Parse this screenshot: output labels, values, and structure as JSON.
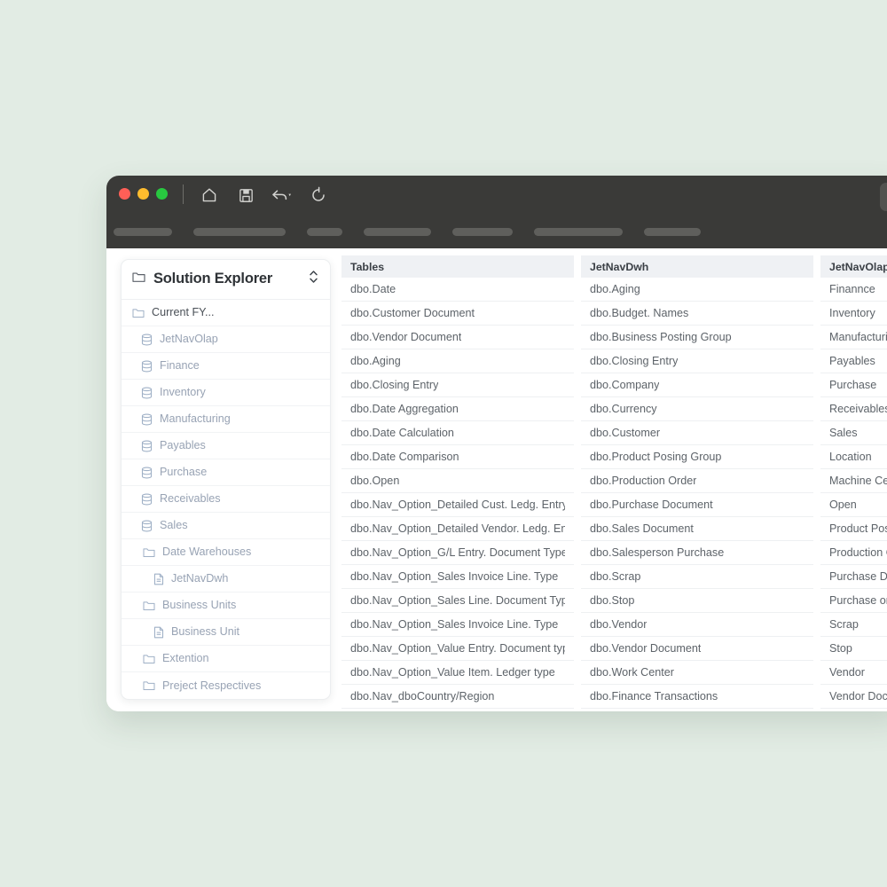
{
  "window": {
    "traffic_lights": [
      "close",
      "minimize",
      "maximize"
    ],
    "toolbar_icons": [
      "home-icon",
      "save-icon",
      "undo-dropdown-icon",
      "refresh-icon"
    ],
    "search_icon": "search-icon",
    "menu_pill_widths": [
      66,
      104,
      40,
      76,
      68,
      100,
      64
    ]
  },
  "sidebar": {
    "title": "Solution Explorer",
    "header_icon": "folder-icon",
    "sort_icon": "chevron-up-down-icon",
    "items": [
      {
        "label": "Current FY...",
        "icon": "folder-icon",
        "level": 0
      },
      {
        "label": "JetNavOlap",
        "icon": "database-icon",
        "level": 1
      },
      {
        "label": "Finance",
        "icon": "database-icon",
        "level": 1
      },
      {
        "label": "Inventory",
        "icon": "database-icon",
        "level": 1
      },
      {
        "label": "Manufacturing",
        "icon": "database-icon",
        "level": 1
      },
      {
        "label": "Payables",
        "icon": "database-icon",
        "level": 1
      },
      {
        "label": "Purchase",
        "icon": "database-icon",
        "level": 1
      },
      {
        "label": "Receivables",
        "icon": "database-icon",
        "level": 1
      },
      {
        "label": "Sales",
        "icon": "database-icon",
        "level": 1
      },
      {
        "label": "Date Warehouses",
        "icon": "folder-icon",
        "level": 1
      },
      {
        "label": "JetNavDwh",
        "icon": "document-icon",
        "level": 2
      },
      {
        "label": "Business Units",
        "icon": "folder-icon",
        "level": 1
      },
      {
        "label": "Business Unit",
        "icon": "document-icon",
        "level": 2
      },
      {
        "label": "Extention",
        "icon": "folder-icon",
        "level": 1
      },
      {
        "label": "Preject Respectives",
        "icon": "folder-icon",
        "level": 1
      }
    ]
  },
  "tables": [
    {
      "header": "Tables",
      "rows": [
        "dbo.Date",
        "dbo.Customer Document",
        "dbo.Vendor Document",
        "dbo.Aging",
        "dbo.Closing Entry",
        "dbo.Date Aggregation",
        "dbo.Date Calculation",
        "dbo.Date Comparison",
        "dbo.Open",
        "dbo.Nav_Option_Detailed Cust. Ledg. Entry...",
        "dbo.Nav_Option_Detailed Vendor. Ledg. En...",
        "dbo.Nav_Option_G/L Entry. Document Type",
        "dbo.Nav_Option_Sales Invoice Line. Type",
        "dbo.Nav_Option_Sales Line. Document Type",
        "dbo.Nav_Option_Sales Invoice Line. Type",
        "dbo.Nav_Option_Value Entry. Document type",
        "dbo.Nav_Option_Value Item. Ledger type",
        "dbo.Nav_dboCountry/Region"
      ]
    },
    {
      "header": "JetNavDwh",
      "rows": [
        "dbo.Aging",
        "dbo.Budget. Names",
        "dbo.Business Posting Group",
        "dbo.Closing Entry",
        "dbo.Company",
        "dbo.Currency",
        "dbo.Customer",
        "dbo.Product Posing Group",
        "dbo.Production Order",
        "dbo.Purchase Document",
        "dbo.Sales Document",
        "dbo.Salesperson Purchase",
        "dbo.Scrap",
        "dbo.Stop",
        "dbo.Vendor",
        "dbo.Vendor Document",
        "dbo.Work Center",
        "dbo.Finance Transactions"
      ]
    },
    {
      "header": "JetNavOlap",
      "rows": [
        "Finannce",
        "Inventory",
        "Manufacturing",
        "Payables",
        "Purchase",
        "Receivables",
        "Sales",
        "Location",
        "Machine Center",
        "Open",
        "Product Posting Group",
        "Production Order",
        "Purchase Document",
        "Purchase on Order",
        "Scrap",
        "Stop",
        "Vendor",
        "Vendor Document"
      ]
    }
  ],
  "colors": {
    "canvas_background": "#e2ece4",
    "titlebar": "#3a3a38",
    "column_header": "#eff1f4",
    "sidebar_label": "#98a3b4",
    "row_text": "#5d6369"
  }
}
